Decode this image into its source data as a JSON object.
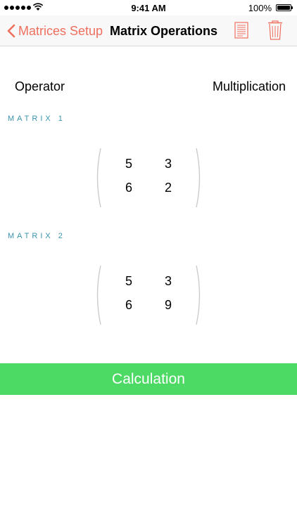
{
  "status_bar": {
    "time": "9:41 AM",
    "battery": "100%"
  },
  "nav": {
    "back_label": "Matrices Setup",
    "title": "Matrix Operations",
    "notes_icon": "notes-icon",
    "trash_icon": "trash-icon",
    "accent_color": "#ef6f5f"
  },
  "operator": {
    "label": "Operator",
    "value": "Multiplication"
  },
  "matrices": [
    {
      "header": "MATRIX 1",
      "rows": [
        [
          "5",
          "3"
        ],
        [
          "6",
          "2"
        ]
      ]
    },
    {
      "header": "MATRIX 2",
      "rows": [
        [
          "5",
          "3"
        ],
        [
          "6",
          "9"
        ]
      ]
    }
  ],
  "calculate": {
    "label": "Calculation",
    "color": "#4cd964"
  },
  "section_header_color": "#3a93ad"
}
